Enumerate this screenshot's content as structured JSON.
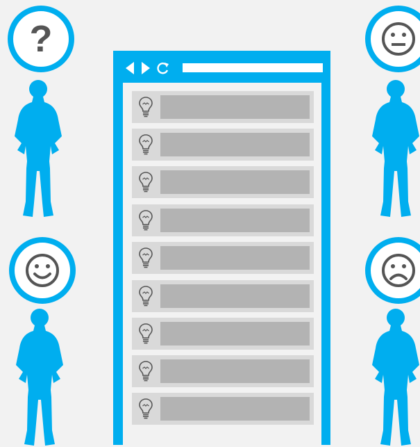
{
  "colors": {
    "accent": "#00aeef",
    "background": "#f2f2f2",
    "row": "#d9d9d9",
    "bar": "#b3b3b3",
    "icon": "#555555"
  },
  "personas": [
    {
      "name": "confused",
      "bubble": "?"
    },
    {
      "name": "neutral",
      "bubble": "neutral-face-icon"
    },
    {
      "name": "happy",
      "bubble": "smile-face-icon"
    },
    {
      "name": "sad",
      "bubble": "sad-face-icon"
    }
  ],
  "browser": {
    "toolbar_icons": [
      "back-arrow-icon",
      "forward-arrow-icon",
      "refresh-icon"
    ],
    "address_bar_text": "",
    "item_count": 9,
    "item_icon": "lightbulb-icon"
  }
}
